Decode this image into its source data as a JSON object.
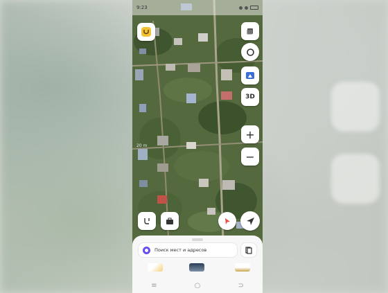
{
  "status_bar": {
    "time": "9:23"
  },
  "map": {
    "scale_label": "20 m",
    "controls": {
      "layers_icon": "layers-icon",
      "refresh_icon": "rotate-icon",
      "panorama_icon": "panorama-icon",
      "three_d_label": "3D",
      "zoom_in_label": "+",
      "zoom_out_label": "−",
      "route_icon": "route-icon",
      "bag_icon": "briefcase-icon",
      "point_icon": "location-pin-icon",
      "navigate_icon": "navigation-arrow-icon",
      "profile_icon": "profile-badge-icon"
    }
  },
  "bottom_sheet": {
    "search_placeholder": "Поиск мест и адресов",
    "bookmarks_icon": "bookmarks-icon"
  },
  "nav_bar": {
    "menu_icon": "≡",
    "home_icon": "○",
    "back_icon": "⊃"
  },
  "colors": {
    "accent": "#6a4cf0",
    "profile_badge": "#f1c232",
    "pin_red": "#e84d3d"
  }
}
